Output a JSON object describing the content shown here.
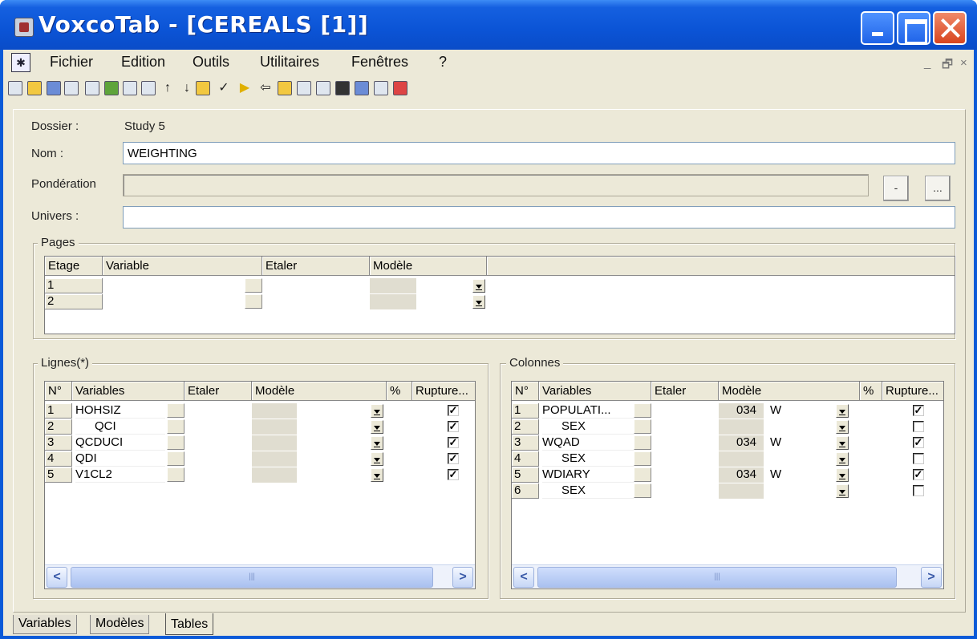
{
  "window": {
    "title": "VoxcoTab - [CEREALS [1]]"
  },
  "menu": [
    "Fichier",
    "Edition",
    "Outils",
    "Utilitaires",
    "Fenêtres",
    "?"
  ],
  "mdi_controls": [
    "_",
    "🗗",
    "×"
  ],
  "toolbar_icons": [
    "new-icon",
    "open-icon",
    "save-icon",
    "columns-icon",
    "rows-icon",
    "copy-vars-icon",
    "copy-icon",
    "paste-icon",
    "up-arrow-icon",
    "down-arrow-icon",
    "edit-icon",
    "check-icon",
    "run-icon",
    "back-icon",
    "report-icon",
    "grid-icon",
    "list-icon",
    "export-icon",
    "preview-icon",
    "print-icon",
    "exit-icon"
  ],
  "form": {
    "dossier_label": "Dossier :",
    "dossier_value": "Study 5",
    "nom_label": "Nom :",
    "nom_value": "WEIGHTING",
    "ponderation_label": "Pondération",
    "ponderation_value": "",
    "ponderation_btn1": "-",
    "ponderation_btn2": "...",
    "univers_label": "Univers :",
    "univers_value": ""
  },
  "pages": {
    "title": "Pages",
    "headers": [
      "Etage",
      "Variable",
      "Etaler",
      "Modèle"
    ],
    "rows": [
      {
        "n": "1"
      },
      {
        "n": "2"
      }
    ]
  },
  "lignes": {
    "title": "Lignes(*)",
    "headers": [
      "N°",
      "Variables",
      "Etaler",
      "Modèle",
      "%",
      "Rupture..."
    ],
    "rows": [
      {
        "n": "1",
        "variable": "HOHSIZ",
        "indent": false,
        "checked": true
      },
      {
        "n": "2",
        "variable": "QCI",
        "indent": true,
        "checked": true
      },
      {
        "n": "3",
        "variable": "QCDUCI",
        "indent": false,
        "checked": true
      },
      {
        "n": "4",
        "variable": "QDI",
        "indent": false,
        "checked": true
      },
      {
        "n": "5",
        "variable": "V1CL2",
        "indent": false,
        "checked": true
      }
    ]
  },
  "colonnes": {
    "title": "Colonnes",
    "headers": [
      "N°",
      "Variables",
      "Etaler",
      "Modèle",
      "%",
      "Rupture..."
    ],
    "rows": [
      {
        "n": "1",
        "variable": "POPULATI...",
        "indent": false,
        "modele_num": "034",
        "modele_code": "W",
        "checked": true
      },
      {
        "n": "2",
        "variable": "SEX",
        "indent": true,
        "modele_num": "",
        "modele_code": "",
        "checked": false
      },
      {
        "n": "3",
        "variable": "WQAD",
        "indent": false,
        "modele_num": "034",
        "modele_code": "W",
        "checked": true
      },
      {
        "n": "4",
        "variable": "SEX",
        "indent": true,
        "modele_num": "",
        "modele_code": "",
        "checked": false
      },
      {
        "n": "5",
        "variable": "WDIARY",
        "indent": false,
        "modele_num": "034",
        "modele_code": "W",
        "checked": true
      },
      {
        "n": "6",
        "variable": "SEX",
        "indent": true,
        "modele_num": "",
        "modele_code": "",
        "checked": false
      }
    ]
  },
  "scroll": {
    "left": "<",
    "right": ">",
    "grip": "|||"
  },
  "tabs": [
    {
      "label": "Variables",
      "active": false
    },
    {
      "label": "Modèles",
      "active": false
    },
    {
      "label": "Tables",
      "active": true
    }
  ]
}
